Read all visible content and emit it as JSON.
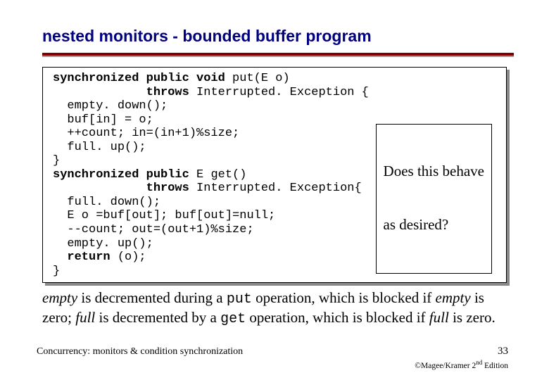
{
  "title": "nested monitors -  bounded buffer program",
  "code": {
    "l1a": "synchronized public void",
    "l1b": " put(E o)",
    "l2a": "             throws",
    "l2b": " Interrupted. Exception {",
    "l3": "  empty. down();",
    "l4": "  buf[in] = o;",
    "l5": "  ++count; in=(in+1)%size;",
    "l6": "  full. up();",
    "l7": "}",
    "l8a": "synchronized public",
    "l8b": " E get()",
    "l9a": "             throws",
    "l9b": " Interrupted. Exception{",
    "l10": "  full. down();",
    "l11": "  E o =buf[out]; buf[out]=null;",
    "l12": "  --count; out=(out+1)%size;",
    "l13": "  empty. up();",
    "l14a": "  return",
    "l14b": " (o);",
    "l15": "}"
  },
  "callout": {
    "line1": "Does this behave",
    "line2": "as desired?"
  },
  "body": {
    "w_empty": "empty",
    "t1": " is decremented during a ",
    "w_put": "put",
    "t2": " operation, which is blocked if ",
    "w_empty2": "empty",
    "t3": " is zero; ",
    "w_full": "full",
    "t4": " is decremented by a ",
    "w_get": "get",
    "t5": " operation, which is blocked if ",
    "w_full2": "full",
    "t6": " is zero."
  },
  "footer": {
    "left": "Concurrency: monitors & condition synchronization",
    "num": "33",
    "right_a": "©Magee/Kramer ",
    "right_b": "2",
    "right_c": "nd",
    "right_d": " Edition"
  }
}
